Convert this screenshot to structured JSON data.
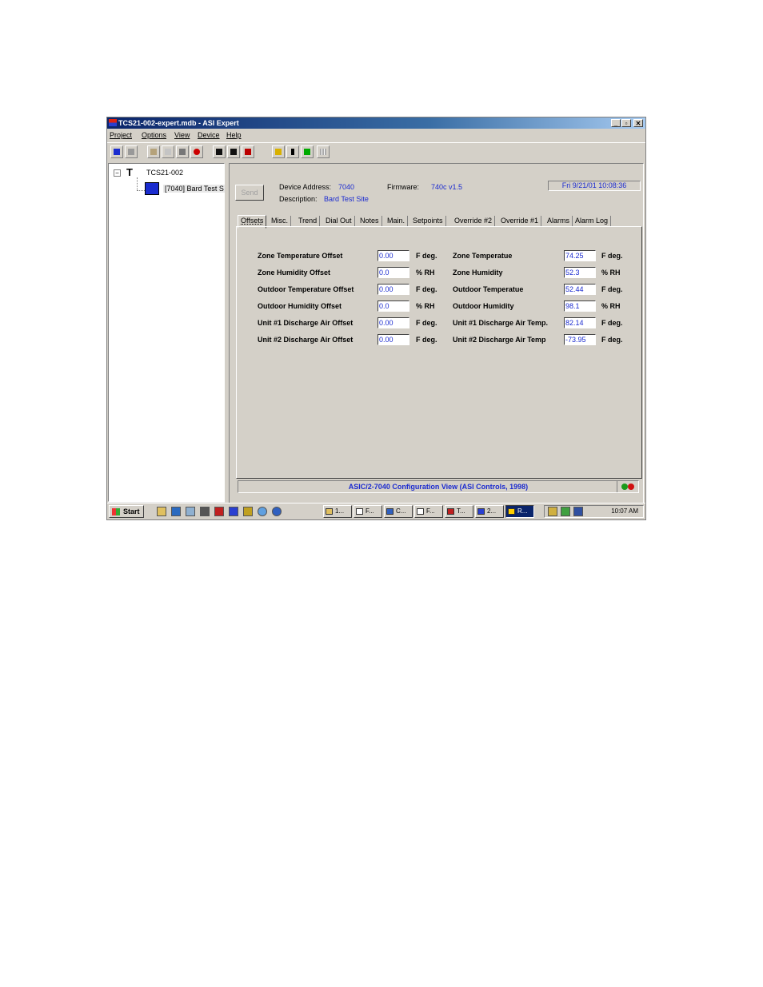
{
  "window": {
    "title": "TCS21-002-expert.mdb - ASI Expert",
    "min_label": "_",
    "max_label": "▫",
    "close_label": "✕"
  },
  "menu": [
    "Project",
    "Options",
    "View",
    "Device",
    "Help"
  ],
  "toolbar_icons": [
    "new-icon",
    "print-icon",
    "cut-icon",
    "copy-icon",
    "find-icon",
    "stop-icon",
    "save-icon",
    "save-all-icon",
    "save-red-icon",
    "home-icon",
    "ti-icon",
    "green-icon",
    "grid-icon"
  ],
  "tree": {
    "root_label": "TCS21-002",
    "expander": "−",
    "root_glyph": "T",
    "device_label": "[7040] Bard Test S"
  },
  "header": {
    "send_label": "Send",
    "device_address_label": "Device Address:",
    "device_address_value": "7040",
    "firmware_label": "Firmware:",
    "firmware_value": "740c v1.5",
    "description_label": "Description:",
    "description_value": "Bard Test Site",
    "datetime": "Fri  9/21/01  10:08:36"
  },
  "tabs": [
    "Offsets",
    "Misc.",
    "Trend",
    "Dial Out",
    "Notes",
    "Main.",
    "Setpoints",
    "Override #2",
    "Override #1",
    "Alarms",
    "Alarm Log"
  ],
  "active_tab": "Offsets",
  "offsets_left": [
    {
      "label": "Zone Temperature Offset",
      "value": "0.00",
      "unit": "F deg."
    },
    {
      "label": "Zone Humidity Offset",
      "value": "0.0",
      "unit": "% RH"
    },
    {
      "label": "Outdoor Temperature Offset",
      "value": "0.00",
      "unit": "F deg."
    },
    {
      "label": "Outdoor Humidity Offset",
      "value": "0.0",
      "unit": "% RH"
    },
    {
      "label": "Unit #1 Discharge Air Offset",
      "value": "0.00",
      "unit": "F deg."
    },
    {
      "label": "Unit #2 Discharge Air Offset",
      "value": "0.00",
      "unit": "F deg."
    }
  ],
  "readings_right": [
    {
      "label": "Zone Temperatue",
      "value": "74.25",
      "unit": "F deg."
    },
    {
      "label": "Zone Humidity",
      "value": "52.3",
      "unit": "% RH"
    },
    {
      "label": "Outdoor Temperatue",
      "value": "52.44",
      "unit": "F deg."
    },
    {
      "label": "Outdoor Humidity",
      "value": "98.1",
      "unit": "% RH"
    },
    {
      "label": "Unit #1 Discharge Air Temp.",
      "value": "82.14",
      "unit": "F deg."
    },
    {
      "label": "Unit #2 Discharge Air Temp",
      "value": "-73.95",
      "unit": "F deg."
    }
  ],
  "status": {
    "text": "ASIC/2-7040 Configuration View (ASI Controls, 1998)",
    "led_colors": [
      "#1a9a1a",
      "#d01010"
    ]
  },
  "taskbar": {
    "start_label": "Start",
    "tasks": [
      "1...",
      "F...",
      "C...",
      "F...",
      "T...",
      "2...",
      "R..."
    ],
    "clock": "10:07 AM"
  }
}
